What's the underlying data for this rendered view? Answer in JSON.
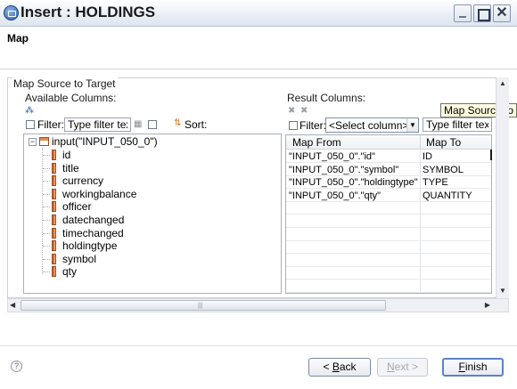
{
  "window": {
    "title": "Insert : HOLDINGS"
  },
  "header": {
    "page_title": "Map"
  },
  "group": {
    "label": "Map Source to Target"
  },
  "available": {
    "label": "Available Columns:",
    "filter_label": "Filter:",
    "filter_value": "Type filter text",
    "sort_label": "Sort:",
    "tree": {
      "root": "input(\"INPUT_050_0\")",
      "columns": [
        "id",
        "title",
        "currency",
        "workingbalance",
        "officer",
        "datechanged",
        "timechanged",
        "holdingtype",
        "symbol",
        "qty"
      ]
    }
  },
  "result": {
    "label": "Result Columns:",
    "filter_label": "Filter:",
    "select_value": "<Select column>",
    "filter_value": "Type filter text",
    "headers": {
      "map_from": "Map From",
      "map_to": "Map To"
    },
    "rows": [
      {
        "from": "\"INPUT_050_0\".\"id\"",
        "to": "ID"
      },
      {
        "from": "\"INPUT_050_0\".\"symbol\"",
        "to": "SYMBOL"
      },
      {
        "from": "\"INPUT_050_0\".\"holdingtype\"",
        "to": "TYPE"
      },
      {
        "from": "\"INPUT_050_0\".\"qty\"",
        "to": "QUANTITY"
      }
    ]
  },
  "tooltip": {
    "text": "Map Source to Target"
  },
  "buttons": {
    "back_prefix": "< ",
    "back_mnemonic": "B",
    "back_rest": "ack",
    "next_mnemonic": "N",
    "next_rest": "ext >",
    "finish_mnemonic": "F",
    "finish_rest": "inish"
  },
  "icons": [
    "app-icon",
    "help-icon",
    "table-icon",
    "column-icon",
    "delete-icon",
    "filter-icon",
    "sort-icon"
  ]
}
